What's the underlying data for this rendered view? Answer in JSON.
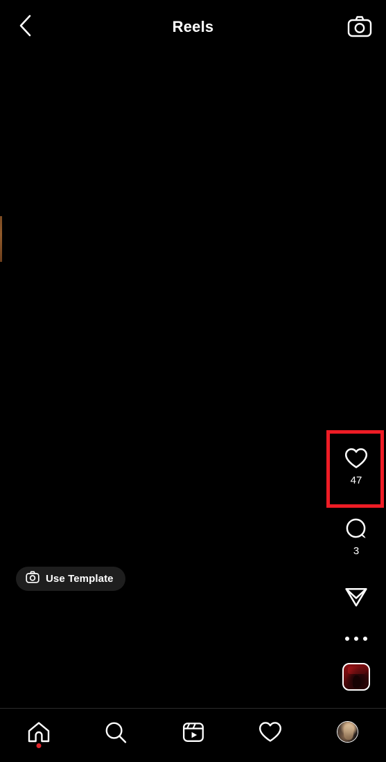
{
  "header": {
    "title": "Reels",
    "back_icon": "chevron-left-icon",
    "camera_icon": "camera-icon"
  },
  "actions": {
    "like": {
      "icon": "heart-icon",
      "count": "47"
    },
    "comment": {
      "icon": "comment-bubble-icon",
      "count": "3"
    },
    "share": {
      "icon": "paper-plane-icon"
    },
    "more": {
      "icon": "ellipsis-icon"
    },
    "audio": {
      "icon": "audio-thumbnail"
    }
  },
  "overlay": {
    "use_template_label": "Use Template",
    "use_template_icon": "camera-icon"
  },
  "annotation": {
    "color": "#ee1c25",
    "target": "like-button"
  },
  "bottom_nav": {
    "items": [
      {
        "name": "home",
        "icon": "home-icon",
        "badge": true
      },
      {
        "name": "search",
        "icon": "search-icon",
        "badge": false
      },
      {
        "name": "reels",
        "icon": "reels-icon",
        "badge": false
      },
      {
        "name": "likes",
        "icon": "heart-icon",
        "badge": false
      },
      {
        "name": "profile",
        "icon": "avatar-icon",
        "badge": false
      }
    ]
  },
  "colors": {
    "background": "#000000",
    "foreground": "#ffffff",
    "accent_red": "#ee1c25",
    "badge_red": "#e0252b",
    "pill_bg": "#1e1e1e"
  }
}
